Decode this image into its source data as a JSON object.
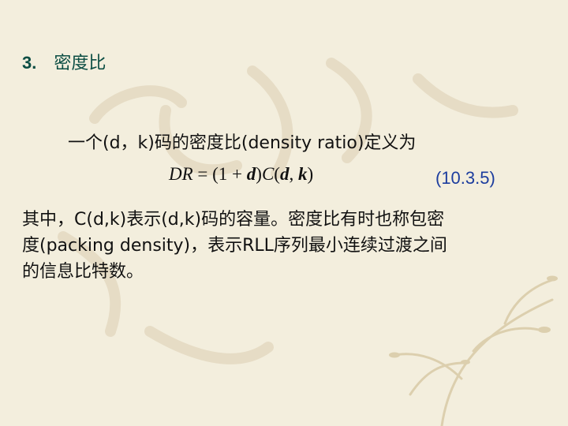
{
  "heading": {
    "number": "3.",
    "title": "密度比"
  },
  "intro": "一个(d，k)码的密度比(density ratio)定义为",
  "formula": {
    "lhs": "DR",
    "eq": " = (1 + ",
    "d": "d",
    "close": ")",
    "c": "C",
    "args_open": "(",
    "arg_d": "d",
    "comma": ", ",
    "arg_k": "k",
    "args_close": ")"
  },
  "equation_number": "(10.3.5)",
  "paragraph": {
    "line1": "其中，C(d,k)表示(d,k)码的容量。密度比有时也称包密",
    "line2": "度(packing density)，表示RLL序列最小连续过渡之间",
    "line3": "的信息比特数。"
  }
}
